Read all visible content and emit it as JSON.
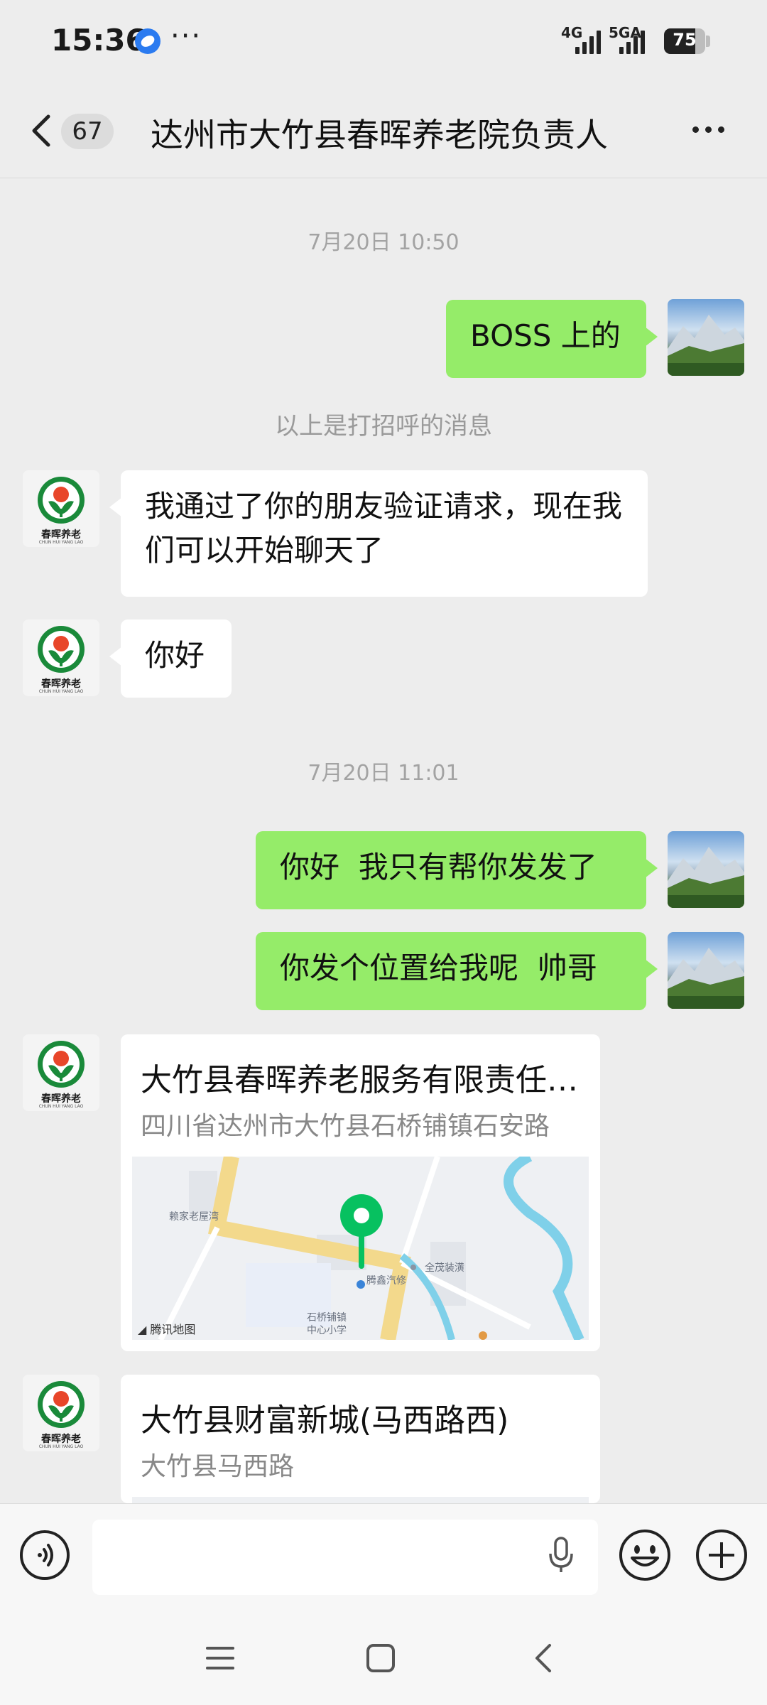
{
  "status_bar": {
    "time": "15:36",
    "more": "···",
    "network_1": "4G",
    "network_2": "5GA",
    "battery": "75"
  },
  "nav": {
    "unread_count": "67",
    "title": "达州市大竹县春晖养老院负责人"
  },
  "messages": {
    "time_1": "7月20日 10:50",
    "out_1": "BOSS 上的",
    "system_1": "以上是打招呼的消息",
    "in_1": "我通过了你的朋友验证请求，现在我们可以开始聊天了",
    "in_2": "你好",
    "time_2": "7月20日 11:01",
    "out_2": "你好  我只有帮你发发了",
    "out_3": "你发个位置给我呢  帅哥"
  },
  "avatar_other_text": "春晖养老",
  "avatar_other_subtext": "CHUN HUI YANG LAO",
  "location_1": {
    "name": "大竹县春晖养老服务有限责任公司",
    "address": "四川省达州市大竹县石桥铺镇石安路",
    "map_labels": [
      "赖家老屋湾",
      "全茂装潢",
      "腾鑫汽修",
      "石桥铺镇",
      "中心小学"
    ],
    "map_credit": "腾讯地图"
  },
  "location_2": {
    "name": "大竹县财富新城(马西路西)",
    "address": "大竹县马西路"
  },
  "input": {
    "placeholder": ""
  },
  "colors": {
    "outgoing_bubble": "#95ec69",
    "incoming_bubble": "#ffffff",
    "background": "#ededed",
    "map_pin": "#07c160"
  }
}
